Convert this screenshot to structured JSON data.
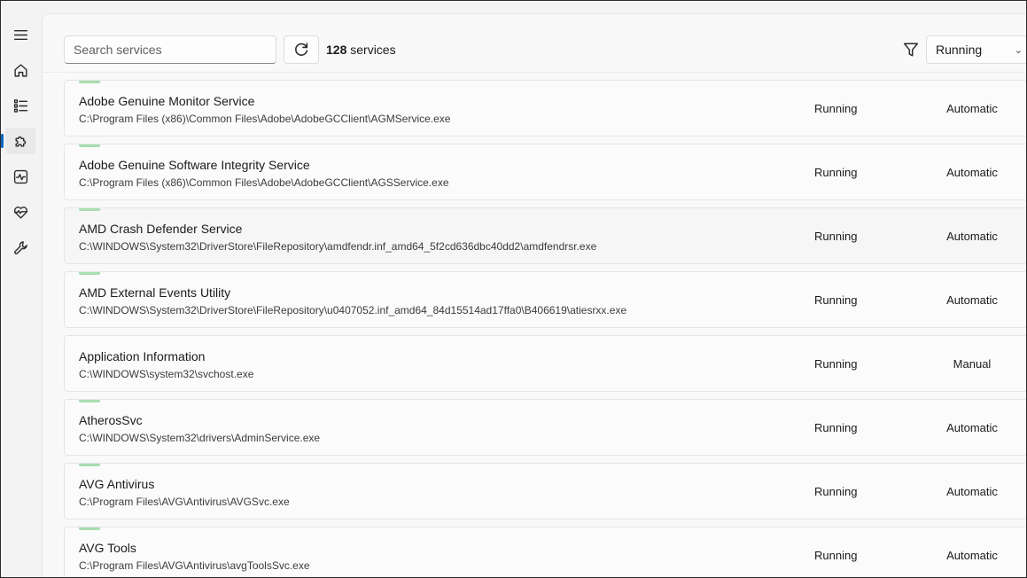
{
  "sidebar": {
    "items": [
      {
        "icon": "menu-icon",
        "name": "menu"
      },
      {
        "icon": "home-icon",
        "name": "home"
      },
      {
        "icon": "list-icon",
        "name": "processes"
      },
      {
        "icon": "puzzle-icon",
        "name": "services"
      },
      {
        "icon": "activity-icon",
        "name": "performance"
      },
      {
        "icon": "health-icon",
        "name": "health"
      },
      {
        "icon": "wrench-icon",
        "name": "tools"
      }
    ],
    "active": "services"
  },
  "toolbar": {
    "search_placeholder": "Search services",
    "count_number": "128",
    "count_label": "services",
    "filter_value": "Running"
  },
  "colors": {
    "accent": "#0067c0",
    "status_indicator": "#a8ddb0"
  },
  "services": [
    {
      "name": "Adobe Genuine Monitor Service",
      "path": "C:\\Program Files (x86)\\Common Files\\Adobe\\AdobeGCClient\\AGMService.exe",
      "status": "Running",
      "startup": "Automatic",
      "indicator": true
    },
    {
      "name": "Adobe Genuine Software Integrity Service",
      "path": "C:\\Program Files (x86)\\Common Files\\Adobe\\AdobeGCClient\\AGSService.exe",
      "status": "Running",
      "startup": "Automatic",
      "indicator": true
    },
    {
      "name": "AMD Crash Defender Service",
      "path": "C:\\WINDOWS\\System32\\DriverStore\\FileRepository\\amdfendr.inf_amd64_5f2cd636dbc40dd2\\amdfendrsr.exe",
      "status": "Running",
      "startup": "Automatic",
      "indicator": true
    },
    {
      "name": "AMD External Events Utility",
      "path": "C:\\WINDOWS\\System32\\DriverStore\\FileRepository\\u0407052.inf_amd64_84d15514ad17ffa0\\B406619\\atiesrxx.exe",
      "status": "Running",
      "startup": "Automatic",
      "indicator": true
    },
    {
      "name": "Application Information",
      "path": "C:\\WINDOWS\\system32\\svchost.exe",
      "status": "Running",
      "startup": "Manual",
      "indicator": false
    },
    {
      "name": "AtherosSvc",
      "path": "C:\\WINDOWS\\System32\\drivers\\AdminService.exe",
      "status": "Running",
      "startup": "Automatic",
      "indicator": true
    },
    {
      "name": "AVG Antivirus",
      "path": "C:\\Program Files\\AVG\\Antivirus\\AVGSvc.exe",
      "status": "Running",
      "startup": "Automatic",
      "indicator": true
    },
    {
      "name": "AVG Tools",
      "path": "C:\\Program Files\\AVG\\Antivirus\\avgToolsSvc.exe",
      "status": "Running",
      "startup": "Automatic",
      "indicator": true
    }
  ]
}
